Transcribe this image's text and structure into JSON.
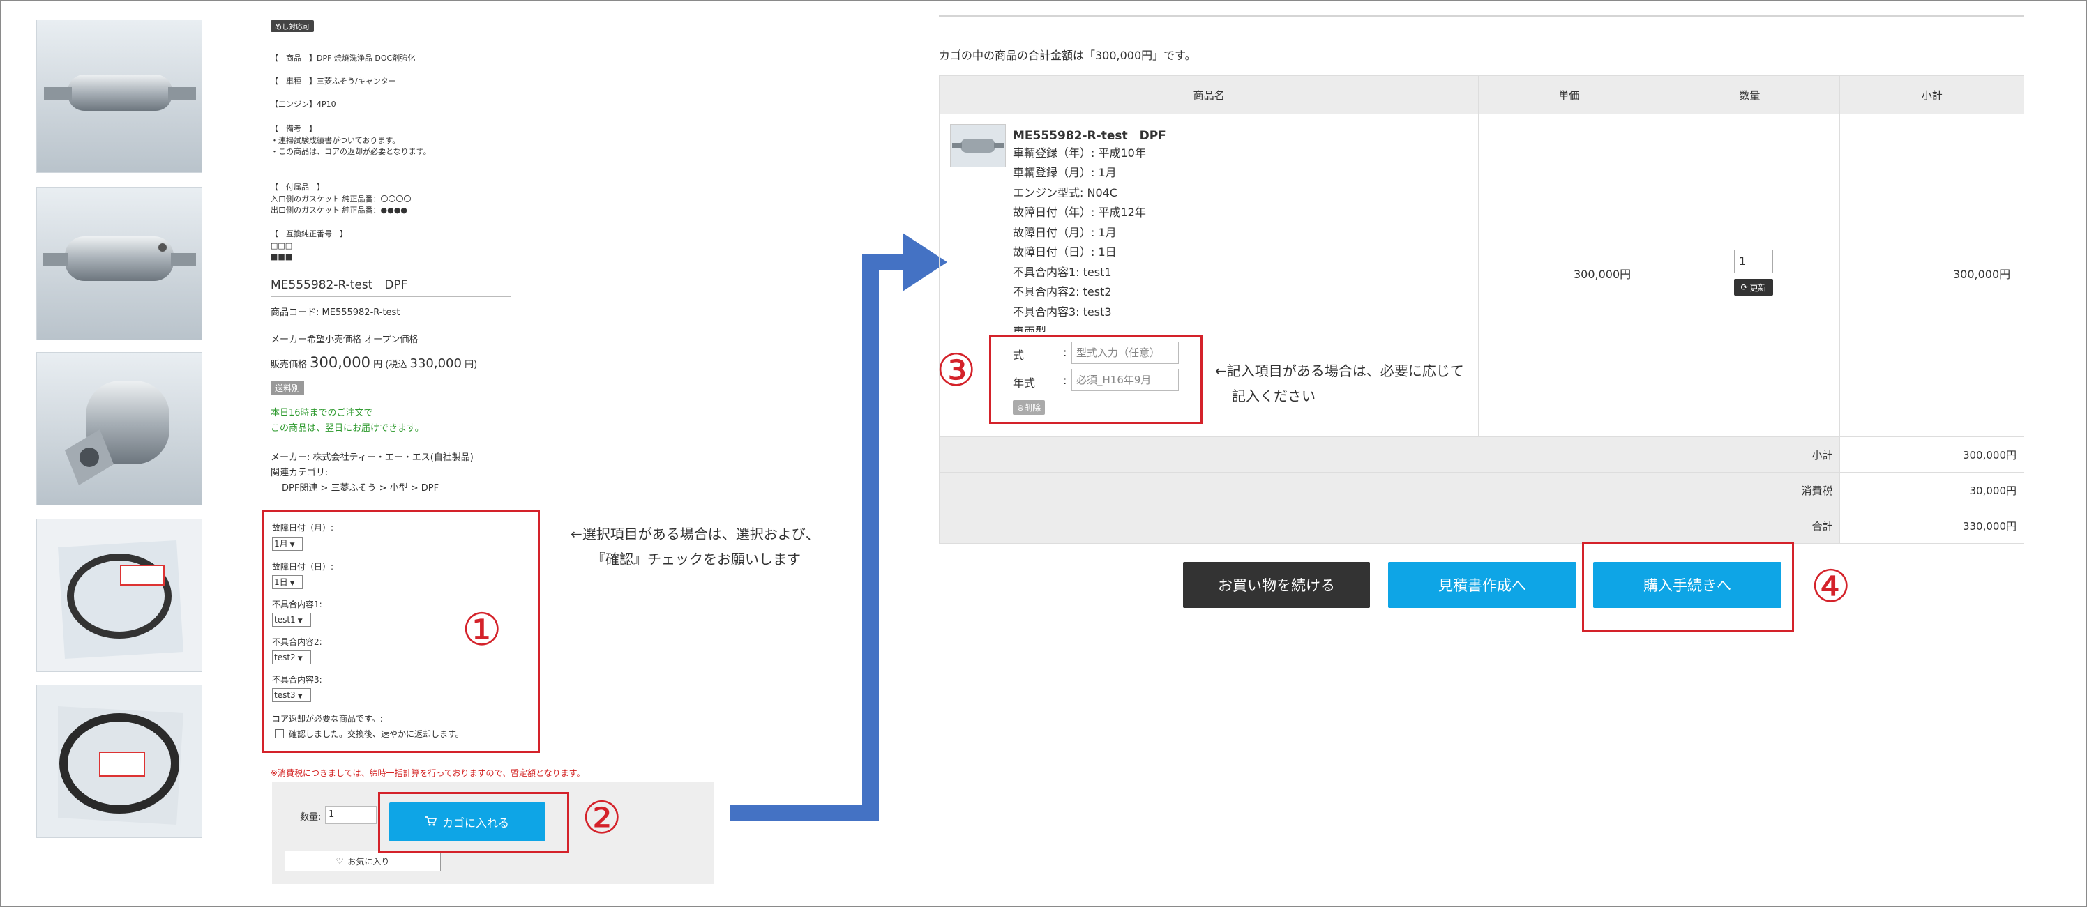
{
  "product": {
    "mail_badge": "めし対応可",
    "lines": [
      "【　商品　】DPF 焼燒洗浄品 DOC剤強化",
      "【　車種　】三菱ふそう/キャンター",
      "【エンジン】4P10"
    ],
    "remarks_head": "【　備考　】",
    "remarks": [
      "・連掃試験成績書がついております。",
      "・この商品は、コアの返却が必要となります。"
    ],
    "parts_head": "【　付属品　】",
    "parts": [
      "入口側のガスケット 純正品番：〇〇〇〇",
      "出口側のガスケット 純正品番：●●●●"
    ],
    "compat_head": "【　互換純正番号　】",
    "compat": [
      "□□□",
      "■■■"
    ],
    "title": "ME555982-R-test　DPF",
    "code_label": "商品コード: ME555982-R-test",
    "maker_price": "メーカー希望小売価格 オープン価格",
    "price_label": "販売価格",
    "price": "300,000",
    "price_unit": "円",
    "tax_price_prefix": "(税込",
    "tax_price": "330,000",
    "tax_price_suffix": "円)",
    "ship_free": "送料別",
    "order_deadline": "本日16時までのご注文で",
    "delivery": "この商品は、翌日にお届けできます。",
    "maker": "メーカー: 株式会社ティー・エー・エス(自社製品)",
    "related_label": "関連カテゴリ:",
    "related_path": "DPF関連 > 三菱ふそう > 小型 > DPF"
  },
  "options": [
    {
      "label": "故障日付（月）:",
      "value": "1月"
    },
    {
      "label": "故障日付（日）:",
      "value": "1日"
    },
    {
      "label": "不具合内容1:",
      "value": "test1"
    },
    {
      "label": "不具合内容2:",
      "value": "test2"
    },
    {
      "label": "不具合内容3:",
      "value": "test3"
    }
  ],
  "core_return": {
    "label": "コア返却が必要な商品です。:",
    "checkbox": "確認しました。交換後、速やかに返却します。"
  },
  "tax_notice": "※消費税につきましては、締時一括計算を行っておりますので、暫定額となります。",
  "cart_form": {
    "qty_label": "数量:",
    "qty_value": "1",
    "add_button": "カゴに入れる",
    "favorite_button": "お気に入り"
  },
  "annotations": {
    "n1": "①",
    "n2": "②",
    "n3": "③",
    "n4": "④",
    "note1_line1": "←選択項目がある場合は、選択および、",
    "note1_line2": "『確認』チェックをお願いします",
    "note3_line1": "←記入項目がある場合は、必要に応じて",
    "note3_line2": "記入ください"
  },
  "cart": {
    "summary": "カゴの中の商品の合計金額は「300,000円」です。",
    "headers": [
      "商品名",
      "単価",
      "数量",
      "小計"
    ],
    "item_name": "ME555982-R-test　DPF",
    "specs": [
      "車輌登録（年）: 平成10年",
      "車輌登録（月）: 1月",
      "エンジン型式: N04C",
      "故障日付（年）: 平成12年",
      "故障日付（月）: 1月",
      "故障日付（日）: 1日",
      "不具合内容1: test1",
      "不具合内容2: test2",
      "不具合内容3: test3",
      "車両型"
    ],
    "opt_model_label": "式",
    "opt_model_placeholder": "型式入力（任意）",
    "opt_year_label": "年式",
    "opt_year_placeholder": "必須_H16年9月",
    "colon": ":",
    "delete_button": "削除",
    "unit_price": "300,000円",
    "qty": "1",
    "update_button": "更新",
    "line_subtotal": "300,000円",
    "subtotal_label": "小計",
    "subtotal": "300,000円",
    "tax_label": "消費税",
    "tax": "30,000円",
    "total_label": "合計",
    "total": "330,000円",
    "continue_button": "お買い物を続ける",
    "estimate_button": "見積書作成へ",
    "checkout_button": "購入手続きへ"
  },
  "colors": {
    "accent_blue": "#0ea5e6",
    "annotation_red": "#d4222a",
    "arrow_blue": "#4472c4",
    "dark_button": "#333333"
  }
}
